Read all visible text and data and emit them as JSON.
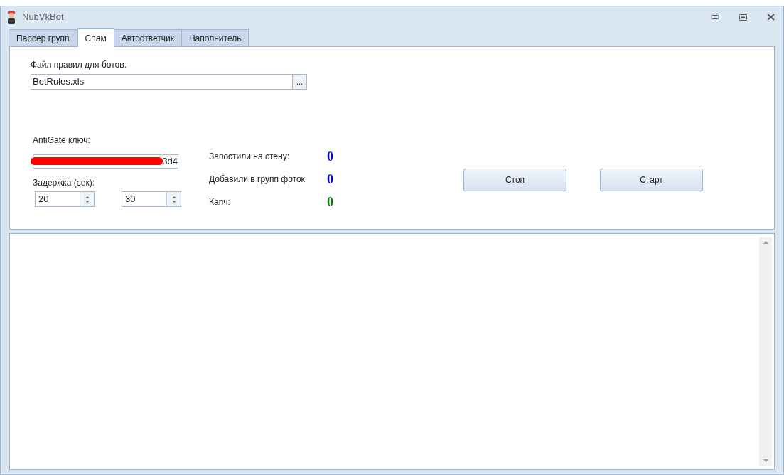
{
  "window": {
    "title": "NubVkBot"
  },
  "tabs": [
    {
      "label": "Парсер групп",
      "selected": false
    },
    {
      "label": "Спам",
      "selected": true
    },
    {
      "label": "Автоответчик",
      "selected": false
    },
    {
      "label": "Наполнитель",
      "selected": false
    }
  ],
  "rules_file": {
    "label": "Файл правил для ботов:",
    "value": "BotRules.xls",
    "browse": "..."
  },
  "antigate": {
    "label": "AntiGate ключ:",
    "value": "3d4"
  },
  "delay": {
    "label": "Задержка (сек):",
    "min": "20",
    "max": "30"
  },
  "stats": [
    {
      "label": "Запостили на стену:",
      "value": "0",
      "color": "#0000cc"
    },
    {
      "label": "Добавили в групп фоток:",
      "value": "0",
      "color": "#0000cc"
    },
    {
      "label": "Капч:",
      "value": "0",
      "color": "#008000"
    }
  ],
  "buttons": [
    {
      "label": "Стоп"
    },
    {
      "label": "Старт"
    }
  ]
}
